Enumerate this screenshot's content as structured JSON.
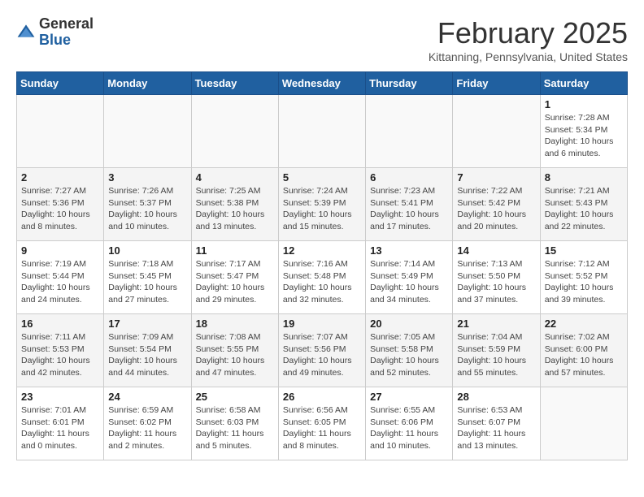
{
  "logo": {
    "general": "General",
    "blue": "Blue"
  },
  "header": {
    "month": "February 2025",
    "location": "Kittanning, Pennsylvania, United States"
  },
  "weekdays": [
    "Sunday",
    "Monday",
    "Tuesday",
    "Wednesday",
    "Thursday",
    "Friday",
    "Saturday"
  ],
  "weeks": [
    [
      {
        "day": "",
        "info": ""
      },
      {
        "day": "",
        "info": ""
      },
      {
        "day": "",
        "info": ""
      },
      {
        "day": "",
        "info": ""
      },
      {
        "day": "",
        "info": ""
      },
      {
        "day": "",
        "info": ""
      },
      {
        "day": "1",
        "info": "Sunrise: 7:28 AM\nSunset: 5:34 PM\nDaylight: 10 hours\nand 6 minutes."
      }
    ],
    [
      {
        "day": "2",
        "info": "Sunrise: 7:27 AM\nSunset: 5:36 PM\nDaylight: 10 hours\nand 8 minutes."
      },
      {
        "day": "3",
        "info": "Sunrise: 7:26 AM\nSunset: 5:37 PM\nDaylight: 10 hours\nand 10 minutes."
      },
      {
        "day": "4",
        "info": "Sunrise: 7:25 AM\nSunset: 5:38 PM\nDaylight: 10 hours\nand 13 minutes."
      },
      {
        "day": "5",
        "info": "Sunrise: 7:24 AM\nSunset: 5:39 PM\nDaylight: 10 hours\nand 15 minutes."
      },
      {
        "day": "6",
        "info": "Sunrise: 7:23 AM\nSunset: 5:41 PM\nDaylight: 10 hours\nand 17 minutes."
      },
      {
        "day": "7",
        "info": "Sunrise: 7:22 AM\nSunset: 5:42 PM\nDaylight: 10 hours\nand 20 minutes."
      },
      {
        "day": "8",
        "info": "Sunrise: 7:21 AM\nSunset: 5:43 PM\nDaylight: 10 hours\nand 22 minutes."
      }
    ],
    [
      {
        "day": "9",
        "info": "Sunrise: 7:19 AM\nSunset: 5:44 PM\nDaylight: 10 hours\nand 24 minutes."
      },
      {
        "day": "10",
        "info": "Sunrise: 7:18 AM\nSunset: 5:45 PM\nDaylight: 10 hours\nand 27 minutes."
      },
      {
        "day": "11",
        "info": "Sunrise: 7:17 AM\nSunset: 5:47 PM\nDaylight: 10 hours\nand 29 minutes."
      },
      {
        "day": "12",
        "info": "Sunrise: 7:16 AM\nSunset: 5:48 PM\nDaylight: 10 hours\nand 32 minutes."
      },
      {
        "day": "13",
        "info": "Sunrise: 7:14 AM\nSunset: 5:49 PM\nDaylight: 10 hours\nand 34 minutes."
      },
      {
        "day": "14",
        "info": "Sunrise: 7:13 AM\nSunset: 5:50 PM\nDaylight: 10 hours\nand 37 minutes."
      },
      {
        "day": "15",
        "info": "Sunrise: 7:12 AM\nSunset: 5:52 PM\nDaylight: 10 hours\nand 39 minutes."
      }
    ],
    [
      {
        "day": "16",
        "info": "Sunrise: 7:11 AM\nSunset: 5:53 PM\nDaylight: 10 hours\nand 42 minutes."
      },
      {
        "day": "17",
        "info": "Sunrise: 7:09 AM\nSunset: 5:54 PM\nDaylight: 10 hours\nand 44 minutes."
      },
      {
        "day": "18",
        "info": "Sunrise: 7:08 AM\nSunset: 5:55 PM\nDaylight: 10 hours\nand 47 minutes."
      },
      {
        "day": "19",
        "info": "Sunrise: 7:07 AM\nSunset: 5:56 PM\nDaylight: 10 hours\nand 49 minutes."
      },
      {
        "day": "20",
        "info": "Sunrise: 7:05 AM\nSunset: 5:58 PM\nDaylight: 10 hours\nand 52 minutes."
      },
      {
        "day": "21",
        "info": "Sunrise: 7:04 AM\nSunset: 5:59 PM\nDaylight: 10 hours\nand 55 minutes."
      },
      {
        "day": "22",
        "info": "Sunrise: 7:02 AM\nSunset: 6:00 PM\nDaylight: 10 hours\nand 57 minutes."
      }
    ],
    [
      {
        "day": "23",
        "info": "Sunrise: 7:01 AM\nSunset: 6:01 PM\nDaylight: 11 hours\nand 0 minutes."
      },
      {
        "day": "24",
        "info": "Sunrise: 6:59 AM\nSunset: 6:02 PM\nDaylight: 11 hours\nand 2 minutes."
      },
      {
        "day": "25",
        "info": "Sunrise: 6:58 AM\nSunset: 6:03 PM\nDaylight: 11 hours\nand 5 minutes."
      },
      {
        "day": "26",
        "info": "Sunrise: 6:56 AM\nSunset: 6:05 PM\nDaylight: 11 hours\nand 8 minutes."
      },
      {
        "day": "27",
        "info": "Sunrise: 6:55 AM\nSunset: 6:06 PM\nDaylight: 11 hours\nand 10 minutes."
      },
      {
        "day": "28",
        "info": "Sunrise: 6:53 AM\nSunset: 6:07 PM\nDaylight: 11 hours\nand 13 minutes."
      },
      {
        "day": "",
        "info": ""
      }
    ]
  ]
}
